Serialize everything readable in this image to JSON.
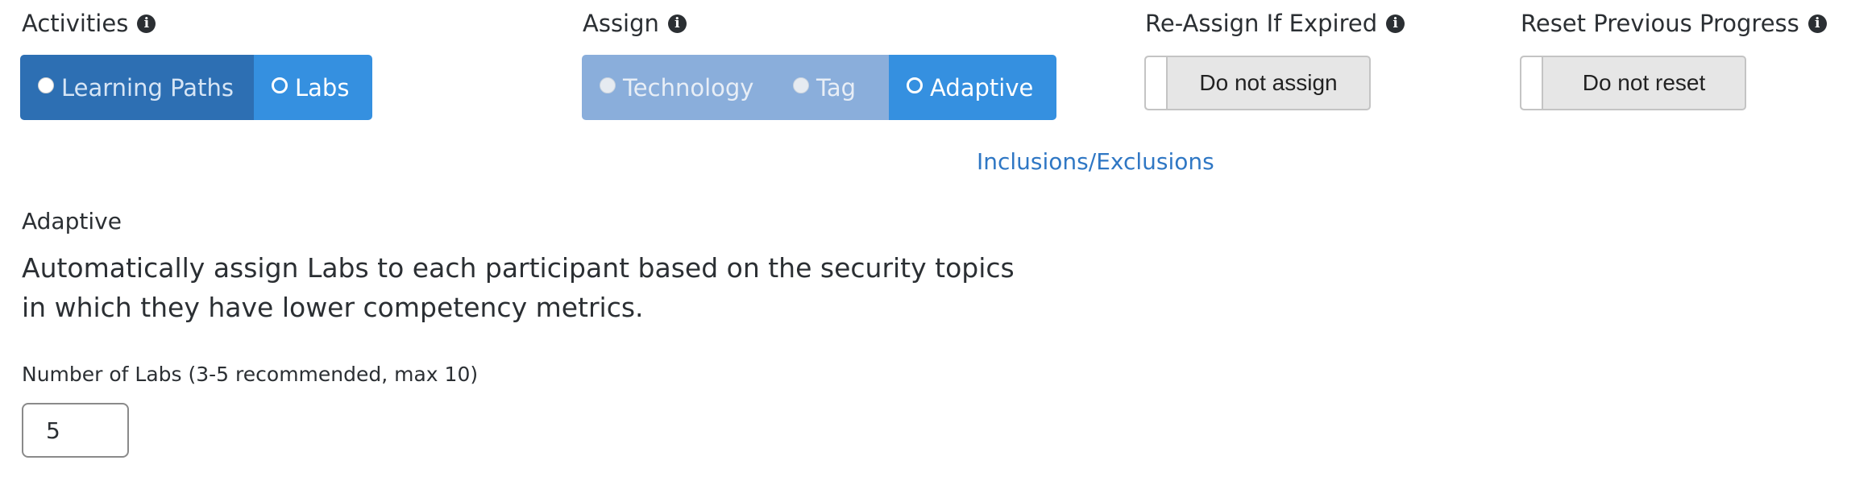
{
  "activities": {
    "label": "Activities",
    "info_icon": "info-icon",
    "options": [
      {
        "label": "Learning Paths",
        "selected": false
      },
      {
        "label": "Labs",
        "selected": true
      }
    ]
  },
  "assign": {
    "label": "Assign",
    "info_icon": "info-icon",
    "options": [
      {
        "label": "Technology",
        "selected": false,
        "disabled": true
      },
      {
        "label": "Tag",
        "selected": false,
        "disabled": true
      },
      {
        "label": "Adaptive",
        "selected": true
      }
    ]
  },
  "reassign": {
    "label": "Re-Assign If Expired",
    "info_icon": "info-icon",
    "button_text": "Do not assign"
  },
  "reset": {
    "label": "Reset Previous Progress",
    "info_icon": "info-icon",
    "button_text": "Do not reset"
  },
  "inclusions_link": "Inclusions/Exclusions",
  "adaptive": {
    "title": "Adaptive",
    "description": "Automatically assign Labs to each participant based on the security topics in which they have lower competency metrics."
  },
  "number_of_labs": {
    "label": "Number of Labs (3-5 recommended, max 10)",
    "value": "5"
  },
  "colors": {
    "selected_segment": "#3590e0",
    "unselected_segment": "#2d6fb3",
    "disabled_segment": "#8aaedb",
    "link": "#2f77c4",
    "text": "#2b2f33"
  }
}
